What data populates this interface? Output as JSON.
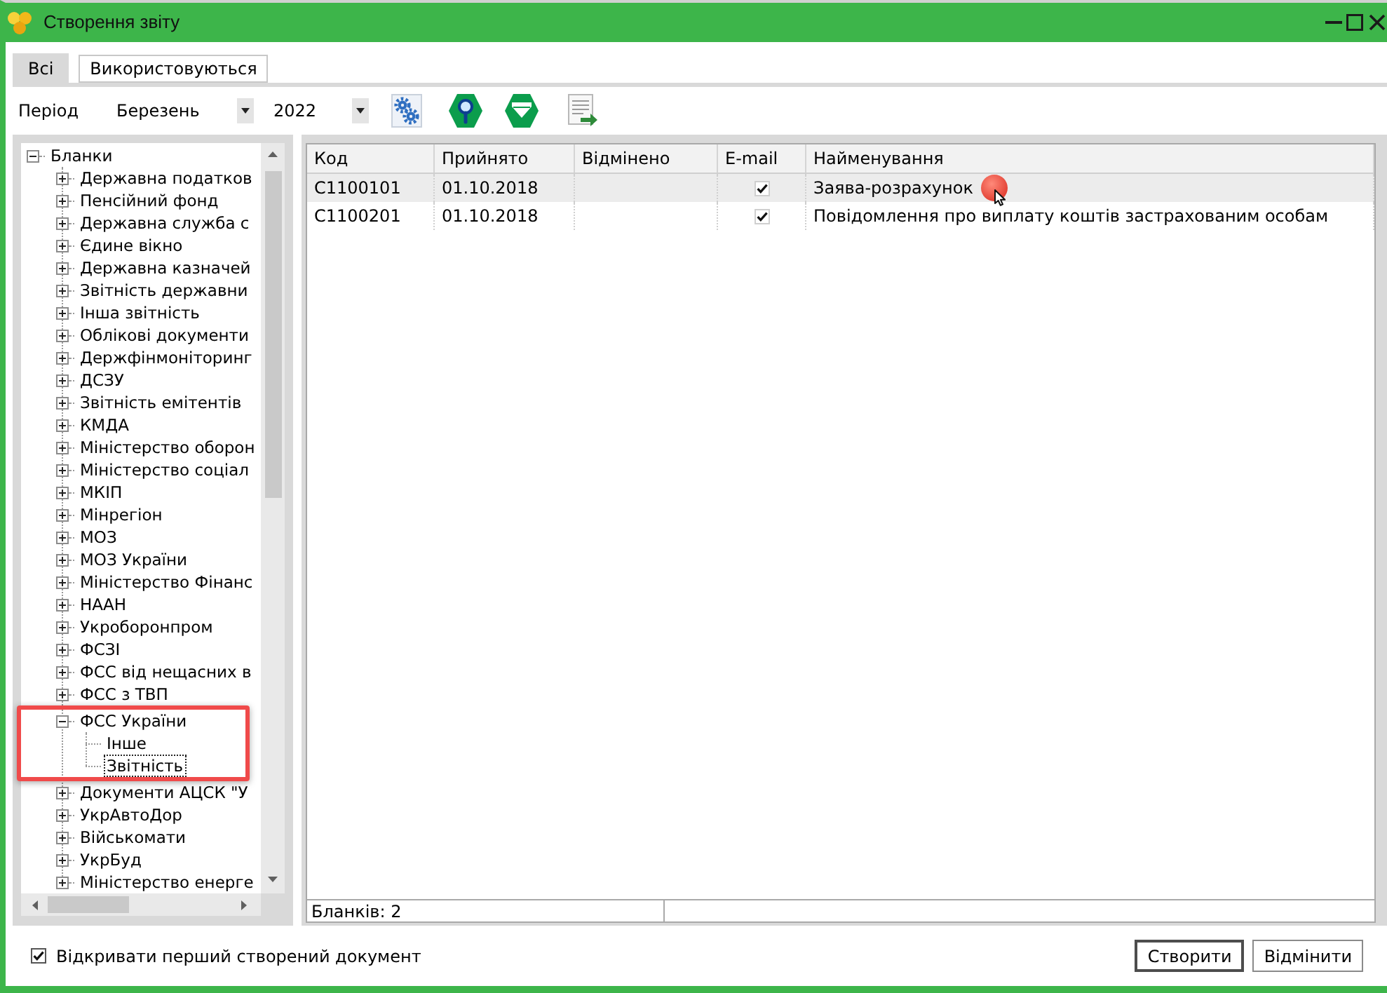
{
  "window": {
    "title": "Створення звіту"
  },
  "tabs": [
    {
      "label": "Всі",
      "selected": true
    },
    {
      "label": "Використовуються",
      "selected": false
    }
  ],
  "toolbar": {
    "period_label": "Період",
    "month": "Березень",
    "year": "2022"
  },
  "tree": {
    "items": [
      {
        "label": "Бланки",
        "expanded": true,
        "selected": false,
        "highlighted": false,
        "children": [
          {
            "label": "Державна податков",
            "expanded": false,
            "selected": false,
            "highlighted": false
          },
          {
            "label": "Пенсійний фонд",
            "expanded": false,
            "selected": false,
            "highlighted": false
          },
          {
            "label": "Державна служба с",
            "expanded": false,
            "selected": false,
            "highlighted": false
          },
          {
            "label": "Єдине вікно",
            "expanded": false,
            "selected": false,
            "highlighted": false
          },
          {
            "label": "Державна казначей",
            "expanded": false,
            "selected": false,
            "highlighted": false
          },
          {
            "label": "Звітність державни",
            "expanded": false,
            "selected": false,
            "highlighted": false
          },
          {
            "label": "Інша звітність",
            "expanded": false,
            "selected": false,
            "highlighted": false
          },
          {
            "label": "Облікові документи",
            "expanded": false,
            "selected": false,
            "highlighted": false
          },
          {
            "label": "Держфінмоніторинг",
            "expanded": false,
            "selected": false,
            "highlighted": false
          },
          {
            "label": "ДСЗУ",
            "expanded": false,
            "selected": false,
            "highlighted": false
          },
          {
            "label": "Звітність емітентів",
            "expanded": false,
            "selected": false,
            "highlighted": false
          },
          {
            "label": "КМДА",
            "expanded": false,
            "selected": false,
            "highlighted": false
          },
          {
            "label": "Міністерство оборон",
            "expanded": false,
            "selected": false,
            "highlighted": false
          },
          {
            "label": "Міністерство соціал",
            "expanded": false,
            "selected": false,
            "highlighted": false
          },
          {
            "label": "МКІП",
            "expanded": false,
            "selected": false,
            "highlighted": false
          },
          {
            "label": "Мінрегіон",
            "expanded": false,
            "selected": false,
            "highlighted": false
          },
          {
            "label": "МОЗ",
            "expanded": false,
            "selected": false,
            "highlighted": false
          },
          {
            "label": "МОЗ України",
            "expanded": false,
            "selected": false,
            "highlighted": false
          },
          {
            "label": "Міністерство Фінанс",
            "expanded": false,
            "selected": false,
            "highlighted": false
          },
          {
            "label": "НААН",
            "expanded": false,
            "selected": false,
            "highlighted": false
          },
          {
            "label": "Укроборонпром",
            "expanded": false,
            "selected": false,
            "highlighted": false
          },
          {
            "label": "ФСЗІ",
            "expanded": false,
            "selected": false,
            "highlighted": false
          },
          {
            "label": "ФСС від нещасних в",
            "expanded": false,
            "selected": false,
            "highlighted": false
          },
          {
            "label": "ФСС з ТВП",
            "expanded": false,
            "selected": false,
            "highlighted": false
          },
          {
            "label": "ФСС України",
            "expanded": true,
            "selected": false,
            "highlighted": true,
            "children": [
              {
                "label": "Інше",
                "selected": false,
                "highlighted": false
              },
              {
                "label": "Звітність",
                "selected": true,
                "highlighted": false
              }
            ]
          },
          {
            "label": "Документи АЦСК \"У",
            "expanded": false,
            "selected": false,
            "highlighted": false
          },
          {
            "label": "УкрАвтоДор",
            "expanded": false,
            "selected": false,
            "highlighted": false
          },
          {
            "label": "Військомати",
            "expanded": false,
            "selected": false,
            "highlighted": false
          },
          {
            "label": "УкрБуд",
            "expanded": false,
            "selected": false,
            "highlighted": false
          },
          {
            "label": "Міністерство енерге",
            "expanded": false,
            "selected": false,
            "highlighted": false
          }
        ]
      }
    ]
  },
  "table": {
    "columns": [
      "Код",
      "Прийнято",
      "Відмінено",
      "E-mail",
      "Найменування"
    ],
    "rows": [
      {
        "code": "C1100101",
        "accepted": "01.10.2018",
        "email": true,
        "name": "Заява-розрахунок",
        "selected": true
      },
      {
        "code": "C1100201",
        "accepted": "01.10.2018",
        "email": true,
        "name": "Повідомлення про виплату коштів застрахованим особам",
        "selected": false
      }
    ],
    "status": "Бланків: 2"
  },
  "open_first_document": {
    "label": "Відкривати перший створений документ",
    "checked": true
  },
  "buttons": [
    {
      "label": "Створити",
      "default": true
    },
    {
      "label": "Відмінити",
      "default": false
    }
  ]
}
